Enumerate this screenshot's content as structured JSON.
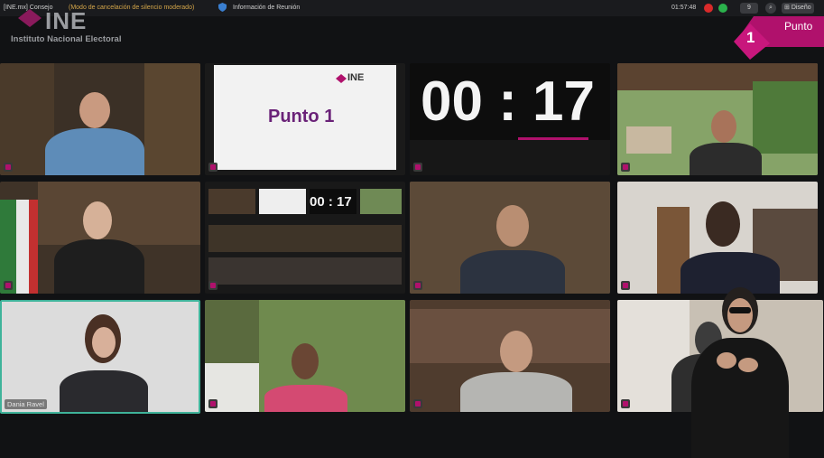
{
  "topbar": {
    "window_title": "[INE.mx] Consejo",
    "mute_notice": "(Modo de cancelación de silencio moderado)",
    "meeting_info": "Información de Reunión",
    "clock": "01:57:48",
    "participants_count": "9",
    "design_label": "Diseño"
  },
  "brand": {
    "short": "INE",
    "full": "Instituto Nacional Electoral"
  },
  "agenda": {
    "number": "1",
    "label": "Punto",
    "slide_title": "Punto 1"
  },
  "timer": {
    "text": "00 : 17"
  },
  "participants": {
    "highlighted_name": "Dania Ravel"
  },
  "colors": {
    "brand_magenta": "#b0116c",
    "highlight_border": "#3fb39a"
  }
}
